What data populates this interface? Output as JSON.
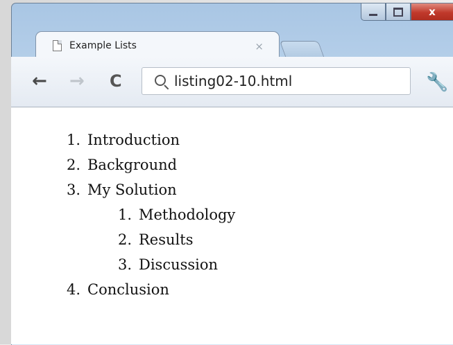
{
  "window": {
    "controls": {
      "minimize": "_",
      "maximize": "□",
      "close": "x"
    }
  },
  "tab": {
    "title": "Example Lists",
    "close": "×"
  },
  "toolbar": {
    "back": "←",
    "forward": "→",
    "reload": "C",
    "url": "listing02-10.html",
    "wrench": "🔧"
  },
  "list": [
    {
      "num": "1.",
      "text": "Introduction"
    },
    {
      "num": "2.",
      "text": "Background"
    },
    {
      "num": "3.",
      "text": "My Solution"
    },
    {
      "num": "1.",
      "text": "Methodology"
    },
    {
      "num": "2.",
      "text": "Results"
    },
    {
      "num": "3.",
      "text": "Discussion"
    },
    {
      "num": "4.",
      "text": "Conclusion"
    }
  ]
}
